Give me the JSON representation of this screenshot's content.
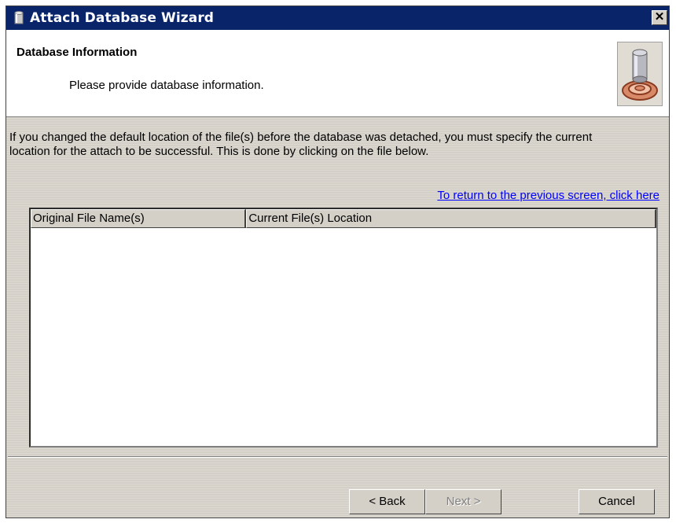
{
  "window": {
    "title": "Attach Database Wizard",
    "close_label": "✕",
    "titlebar_color": "#0a246a"
  },
  "header": {
    "title": "Database Information",
    "subtitle": "Please provide database information.",
    "graphic_icon": "database-wizard-icon"
  },
  "body": {
    "description": "If you changed the default location of the file(s) before the database was detached, you must specify the current location for the attach to be successful. This is done by clicking on the file below.",
    "return_link": "To return to the previous screen, click here",
    "link_color": "#0000ff"
  },
  "grid": {
    "columns": [
      "Original File Name(s)",
      "Current File(s) Location"
    ],
    "rows": []
  },
  "buttons": {
    "back": "< Back",
    "next": "Next >",
    "next_disabled": true,
    "cancel": "Cancel"
  }
}
